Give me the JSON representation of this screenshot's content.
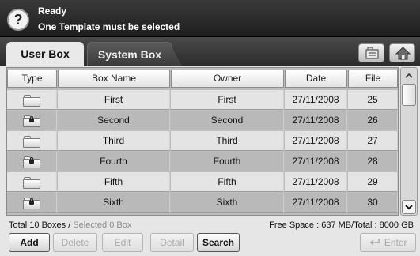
{
  "status": {
    "title": "Ready",
    "message": "One Template must be selected",
    "help_icon": "question-mark-icon"
  },
  "tabs": [
    {
      "label": "User Box",
      "active": true
    },
    {
      "label": "System Box",
      "active": false
    }
  ],
  "toolbar": {
    "folder_tool_icon": "folder-tool-icon",
    "home_icon": "home-icon"
  },
  "table": {
    "headers": {
      "type": "Type",
      "name": "Box Name",
      "owner": "Owner",
      "date": "Date",
      "file": "File"
    },
    "rows": [
      {
        "locked": false,
        "name": "First",
        "owner": "First",
        "date": "27/11/2008",
        "file": "25"
      },
      {
        "locked": true,
        "name": "Second",
        "owner": "Second",
        "date": "27/11/2008",
        "file": "26"
      },
      {
        "locked": false,
        "name": "Third",
        "owner": "Third",
        "date": "27/11/2008",
        "file": "27"
      },
      {
        "locked": true,
        "name": "Fourth",
        "owner": "Fourth",
        "date": "27/11/2008",
        "file": "28"
      },
      {
        "locked": false,
        "name": "Fifth",
        "owner": "Fifth",
        "date": "27/11/2008",
        "file": "29"
      },
      {
        "locked": true,
        "name": "Sixth",
        "owner": "Sixth",
        "date": "27/11/2008",
        "file": "30"
      }
    ]
  },
  "scrollbar": {
    "up_glyph": "^",
    "down_glyph": "v"
  },
  "info": {
    "total": "Total 10 Boxes /",
    "selected": "Selected 0 Box",
    "free_space": "Free Space : 637 MB/Total : 8000 GB"
  },
  "buttons": {
    "add": "Add",
    "delete": "Delete",
    "edit": "Edit",
    "detail": "Detail",
    "search": "Search",
    "enter": "Enter"
  },
  "colors": {
    "status_bg": "#2a2a2a",
    "row_light": "#e4e4e4",
    "row_dark": "#b9b9b9",
    "disabled_text": "#a9a9a9"
  }
}
